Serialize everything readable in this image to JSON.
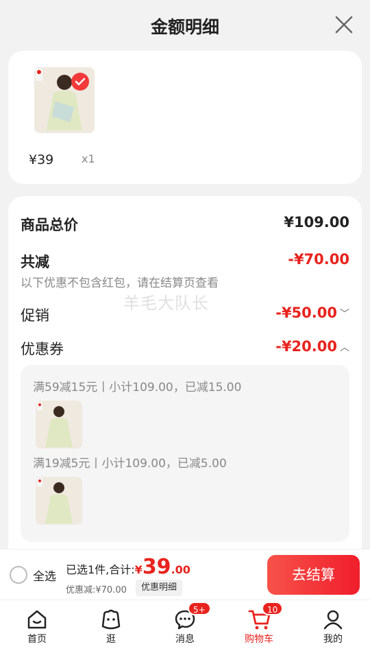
{
  "header": {
    "title": "金额明细"
  },
  "product": {
    "price": "¥39",
    "qty": "x1"
  },
  "breakdown": {
    "total_label": "商品总价",
    "total_value": "¥109.00",
    "reduce_label": "共减",
    "reduce_value": "-¥70.00",
    "note": "以下优惠不包含红包，请在结算页查看",
    "promo_label": "促销",
    "promo_value": "-¥50.00",
    "coupon_label": "优惠券",
    "coupon_value": "-¥20.00",
    "coupon1": "满59减15元丨小计109.00，已减15.00",
    "coupon2": "满19减5元丨小计109.00，已减5.00"
  },
  "watermark": "羊毛大队长",
  "bottom": {
    "select_all": "全选",
    "summary_prefix": "已选1件,合计:",
    "currency": "¥",
    "amount_int": "39",
    "amount_dec": ".00",
    "discount": "优惠减:¥70.00",
    "detail_button": "优惠明细",
    "checkout": "去结算"
  },
  "tabs": [
    {
      "label": "首页",
      "icon": "home-icon"
    },
    {
      "label": "逛",
      "icon": "smile-icon"
    },
    {
      "label": "消息",
      "icon": "message-icon",
      "badge": "5+"
    },
    {
      "label": "购物车",
      "icon": "cart-icon",
      "badge": "10"
    },
    {
      "label": "我的",
      "icon": "profile-icon"
    }
  ],
  "colors": {
    "accent": "#e8231e",
    "background": "#f2f2f2"
  }
}
